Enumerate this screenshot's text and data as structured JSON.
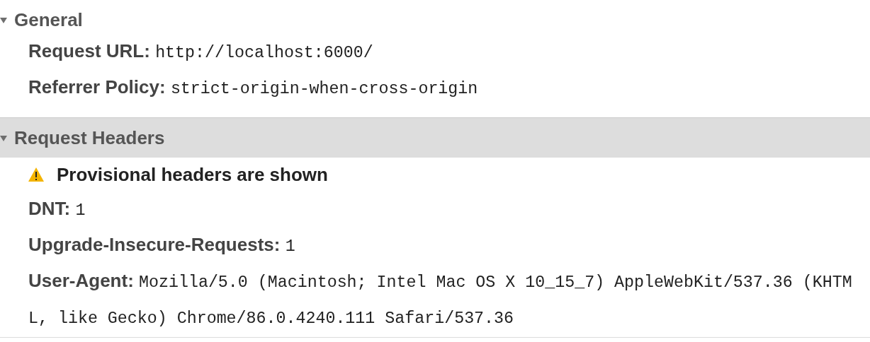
{
  "sections": [
    {
      "title": "General",
      "expanded": true,
      "selected": false,
      "rows": [
        {
          "key": "Request URL:",
          "value": "http://localhost:6000/"
        },
        {
          "key": "Referrer Policy:",
          "value": "strict-origin-when-cross-origin"
        }
      ]
    },
    {
      "title": "Request Headers",
      "expanded": true,
      "selected": true,
      "warning": "Provisional headers are shown",
      "rows": [
        {
          "key": "DNT:",
          "value": "1"
        },
        {
          "key": "Upgrade-Insecure-Requests:",
          "value": "1"
        },
        {
          "key": "User-Agent:",
          "value": "Mozilla/5.0 (Macintosh; Intel Mac OS X 10_15_7) AppleWebKit/537.36 (KHTML, like Gecko) Chrome/86.0.4240.111 Safari/537.36"
        }
      ]
    }
  ]
}
